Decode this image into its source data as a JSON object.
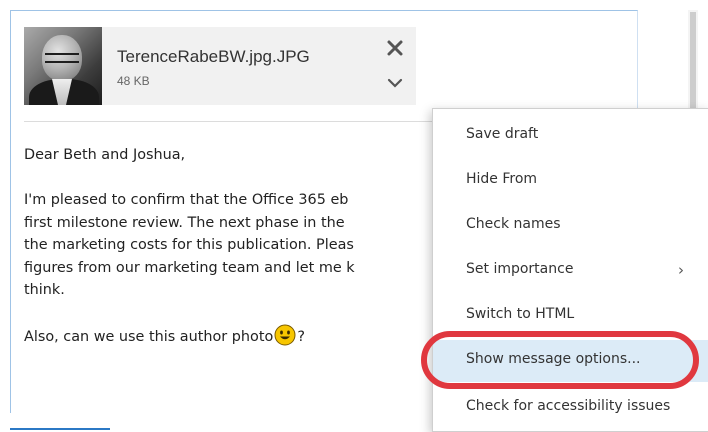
{
  "attachment": {
    "filename": "TerenceRabeBW.jpg.JPG",
    "size": "48 KB"
  },
  "message": {
    "greeting": "Dear Beth and Joshua,",
    "lines": [
      "I'm pleased to confirm that the Office 365 eb",
      "first milestone review. The next phase in the",
      "the marketing costs for this publication. Pleas",
      "figures from our marketing team and let me k",
      "think."
    ],
    "closing_text": "Also, can we use this author photo",
    "closing_end": "?"
  },
  "context_menu": {
    "items": [
      {
        "label": "Save draft"
      },
      {
        "label": "Hide From"
      },
      {
        "label": "Check names"
      },
      {
        "label": "Set importance",
        "submenu": "›"
      },
      {
        "label": "Switch to HTML"
      },
      {
        "label": "Show message options..."
      },
      {
        "label": "Check for accessibility issues"
      }
    ]
  },
  "colors": {
    "highlight_ring": "#e0383f",
    "hover_bg": "#dcebf7",
    "compose_border": "#9fc3e6"
  },
  "icons": {
    "remove_attachment": "close-icon",
    "attachment_options": "chevron-down-icon",
    "emoji": "smiley-emoji-icon"
  }
}
